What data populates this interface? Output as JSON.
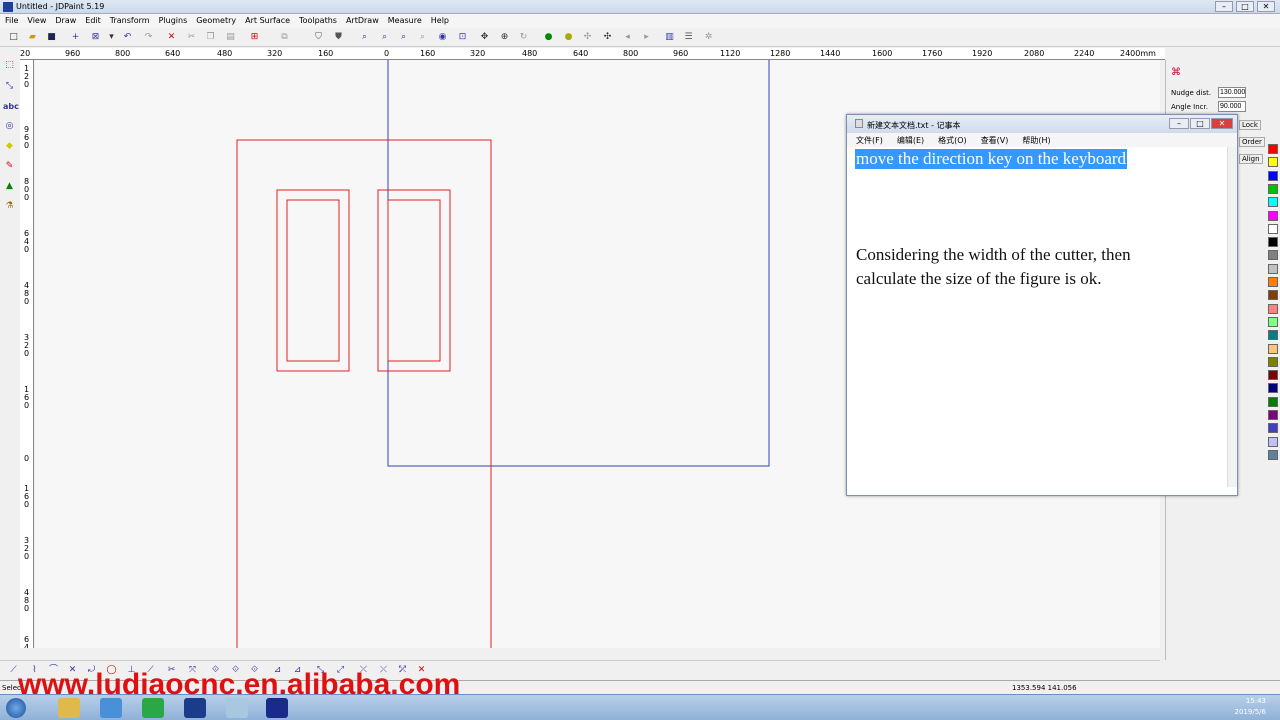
{
  "window": {
    "title": "Untitled - JDPaint 5.19"
  },
  "menu": {
    "items": [
      "File",
      "View",
      "Draw",
      "Edit",
      "Transform",
      "Plugins",
      "Geometry",
      "Art Surface",
      "Toolpaths",
      "ArtDraw",
      "Measure",
      "Help"
    ]
  },
  "ruler_top": {
    "labels": [
      "20",
      "960",
      "800",
      "640",
      "480",
      "320",
      "160",
      "0",
      "160",
      "320",
      "480",
      "640",
      "800",
      "960",
      "1120",
      "1280",
      "1440",
      "1600",
      "1760",
      "1920",
      "2080",
      "2240",
      "2400mm"
    ]
  },
  "ruler_left": {
    "labels": [
      "1\n2\n0",
      "9\n6\n0",
      "8\n0\n0",
      "6\n4\n0",
      "4\n8\n0",
      "3\n2\n0",
      "1\n6\n0",
      "0",
      "1\n6\n0",
      "3\n2\n0",
      "4\n8\n0",
      "6\n4"
    ]
  },
  "rightpanel": {
    "nudge_label": "Nudge dist.",
    "nudge_value": "130.000",
    "angle_label": "Angle Incr.",
    "angle_value": "90.000",
    "lock_label": "Lock",
    "order_label": "Order",
    "align_label": "Align"
  },
  "palette": {
    "colors": [
      "#ff0000",
      "#ffff00",
      "#0000ff",
      "#00c000",
      "#00ffff",
      "#ff00ff",
      "#ffffff",
      "#000000",
      "#808080",
      "#c0c0c0",
      "#ff8000",
      "#804000",
      "#ff8080",
      "#80ff80",
      "#008080",
      "#ffc080",
      "#808000",
      "#800000",
      "#000080",
      "#008000",
      "#800080",
      "#4040c0",
      "#c0c0ff",
      "#6080a0"
    ]
  },
  "notepad": {
    "title": "新建文本文档.txt - 记事本",
    "menu": [
      "文件(F)",
      "编辑(E)",
      "格式(O)",
      "查看(V)",
      "帮助(H)"
    ],
    "selected_line": "move the direction key on the keyboard",
    "line2": "Considering the width of the cutter, then",
    "line3": "calculate the size of the figure is ok."
  },
  "status": {
    "left": "Select",
    "coords": "1353.594 141.056"
  },
  "watermark": {
    "text": "www.ludiaocnc.en.alibaba.com"
  },
  "taskbar": {
    "time": "15:43",
    "date": "2019/5/6"
  }
}
